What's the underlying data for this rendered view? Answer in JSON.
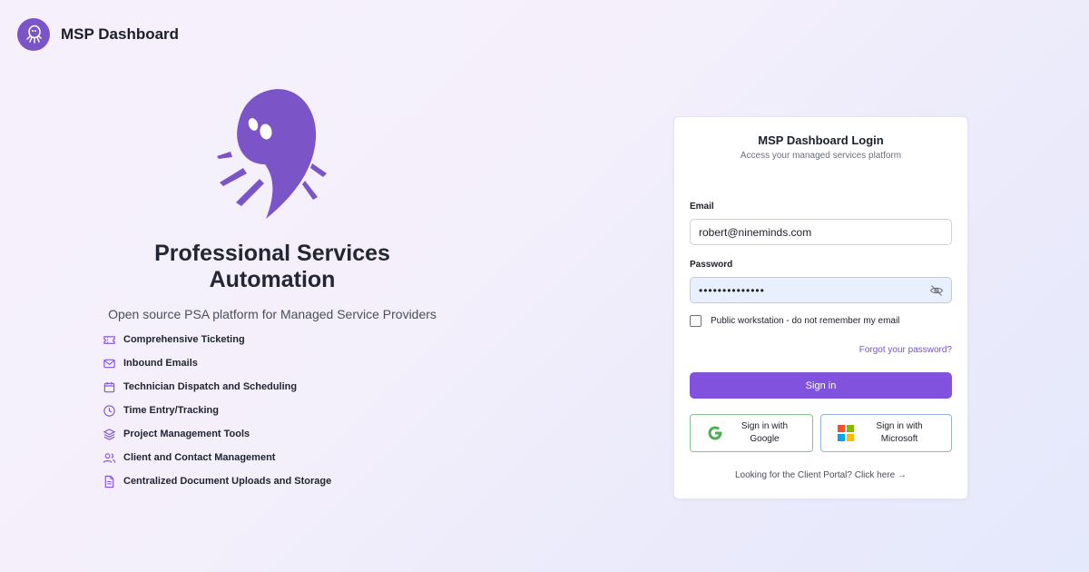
{
  "app": {
    "name": "MSP Dashboard"
  },
  "hero": {
    "title_line1": "Professional Services",
    "title_line2": "Automation",
    "subtitle": "Open source PSA platform for Managed Service Providers",
    "features": [
      {
        "icon": "ticket-icon",
        "label": "Comprehensive Ticketing"
      },
      {
        "icon": "mail-icon",
        "label": "Inbound Emails"
      },
      {
        "icon": "calendar-icon",
        "label": "Technician Dispatch and Scheduling"
      },
      {
        "icon": "clock-icon",
        "label": "Time Entry/Tracking"
      },
      {
        "icon": "layers-icon",
        "label": "Project Management Tools"
      },
      {
        "icon": "users-icon",
        "label": "Client and Contact Management"
      },
      {
        "icon": "document-icon",
        "label": "Centralized Document Uploads and Storage"
      }
    ]
  },
  "login": {
    "title": "MSP Dashboard Login",
    "subtitle": "Access your managed services platform",
    "email_label": "Email",
    "email_value": "robert@nineminds.com",
    "password_label": "Password",
    "password_value": "••••••••••••••",
    "remember_label": "Public workstation - do not remember my email",
    "remember_checked": false,
    "forgot_link": "Forgot your password?",
    "signin_label": "Sign in",
    "google_line1": "Sign in with",
    "google_line2": "Google",
    "microsoft_line1": "Sign in with",
    "microsoft_line2": "Microsoft",
    "portal_link": "Looking for the Client Portal? Click here →"
  },
  "colors": {
    "accent": "#8152de",
    "brand_purple": "#7b55c7",
    "link": "#7a4fd0"
  }
}
